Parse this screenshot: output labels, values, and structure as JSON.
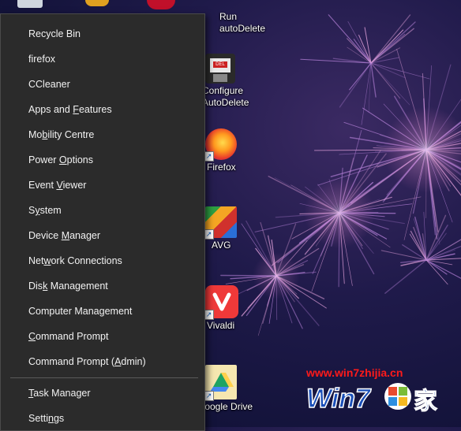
{
  "menu": {
    "items": [
      {
        "label": "Recycle Bin",
        "key": ""
      },
      {
        "label": "firefox",
        "key": ""
      },
      {
        "label": "CCleaner",
        "key": ""
      },
      {
        "label": "Apps and Features",
        "key": "F"
      },
      {
        "label": "Mobility Centre",
        "key": "b"
      },
      {
        "label": "Power Options",
        "key": "O"
      },
      {
        "label": "Event Viewer",
        "key": "V"
      },
      {
        "label": "System",
        "key": "y"
      },
      {
        "label": "Device Manager",
        "key": "M"
      },
      {
        "label": "Network Connections",
        "key": "w"
      },
      {
        "label": "Disk Management",
        "key": "k"
      },
      {
        "label": "Computer Management",
        "key": "g"
      },
      {
        "label": "Command Prompt",
        "key": "C"
      },
      {
        "label": "Command Prompt (Admin)",
        "key": "A"
      }
    ],
    "items2": [
      {
        "label": "Task Manager",
        "key": "T"
      },
      {
        "label": "Settings",
        "key": "n"
      }
    ]
  },
  "desktop_icons": [
    {
      "label": "Run\nautoDelete",
      "icon": "run-autodelete-icon"
    },
    {
      "label": "Configure\nAutoDelete",
      "icon": "configure-autodelete-icon"
    },
    {
      "label": "Firefox",
      "icon": "firefox-icon"
    },
    {
      "label": "AVG",
      "icon": "avg-icon"
    },
    {
      "label": "Vivaldi",
      "icon": "vivaldi-icon"
    },
    {
      "label": "Google Drive",
      "icon": "google-drive-icon"
    }
  ],
  "watermark": {
    "url": "www.win7zhijia.cn",
    "logo": "Win7之家"
  }
}
